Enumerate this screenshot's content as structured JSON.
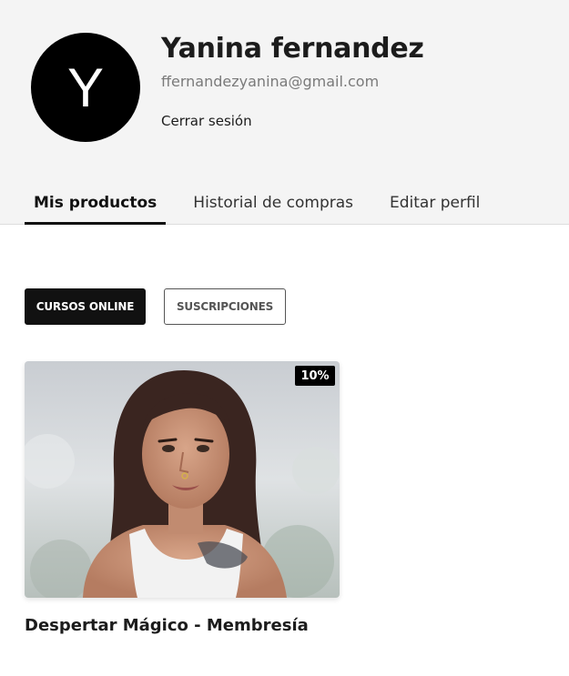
{
  "profile": {
    "avatar_initial": "Y",
    "name": "Yanina fernandez",
    "email": "ffernandezyanina@gmail.com",
    "logout_label": "Cerrar sesión"
  },
  "tabs": [
    {
      "label": "Mis productos",
      "active": true
    },
    {
      "label": "Historial de compras",
      "active": false
    },
    {
      "label": "Editar perfil",
      "active": false
    }
  ],
  "filters": [
    {
      "label": "CURSOS ONLINE",
      "active": true
    },
    {
      "label": "SUSCRIPCIONES",
      "active": false
    }
  ],
  "products": [
    {
      "title": "Despertar Mágico - Membresía",
      "discount_badge": "10%"
    }
  ],
  "colors": {
    "header_bg": "#f4f4f4",
    "avatar_bg": "#000000",
    "accent": "#111111"
  }
}
